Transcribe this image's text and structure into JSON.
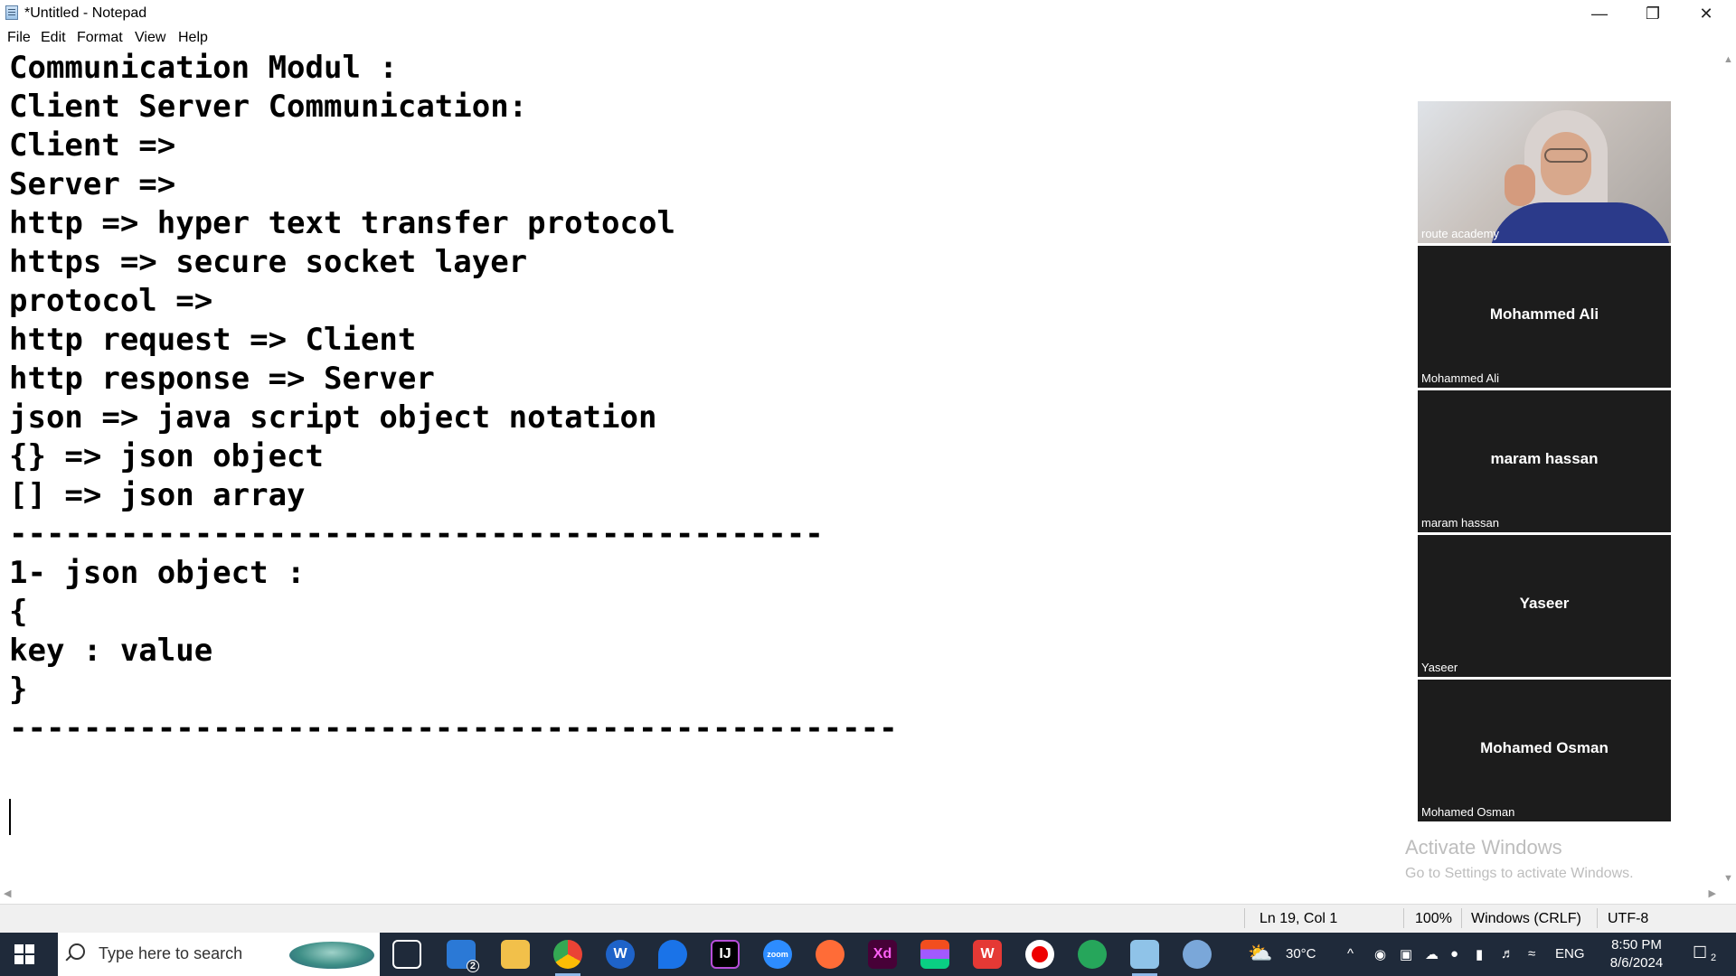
{
  "window": {
    "title": "*Untitled - Notepad",
    "controls": [
      "minimize",
      "maximize",
      "close"
    ]
  },
  "menu": [
    "File",
    "Edit",
    "Format",
    "View",
    "Help"
  ],
  "editor": {
    "lines": [
      "Communication Modul :",
      "Client Server Communication:",
      "Client =>",
      "Server =>",
      "http => hyper text transfer protocol",
      "https => secure socket layer",
      "protocol =>",
      "http request => Client",
      "http response => Server",
      "json => java script object notation",
      "{} => json object",
      "[] => json array",
      "--------------------------------------------",
      "1- json object :",
      "{",
      "key : value",
      "}",
      "------------------------------------------------",
      ""
    ]
  },
  "status": {
    "position": "Ln 19, Col 1",
    "zoom": "100%",
    "line_ending": "Windows (CRLF)",
    "encoding": "UTF-8"
  },
  "participants": [
    {
      "label": "route academy",
      "video": true
    },
    {
      "name": "Mohammed Ali",
      "label": "Mohammed Ali"
    },
    {
      "name": "maram hassan",
      "label": "maram hassan"
    },
    {
      "name": "Yaseer",
      "label": "Yaseer"
    },
    {
      "name": "Mohamed Osman",
      "label": "Mohamed Osman"
    }
  ],
  "watermark": {
    "line1": "Activate Windows",
    "line2": "Go to Settings to activate Windows."
  },
  "taskbar": {
    "search_placeholder": "Type here to search",
    "mail_badge": "2",
    "apps": [
      "start-icon",
      "task-view-icon",
      "mail-icon",
      "file-explorer-icon",
      "chrome-icon",
      "app-icon",
      "maps-icon",
      "intellij-icon",
      "zoom-icon",
      "postman-icon",
      "adobe-xd-icon",
      "figma-icon",
      "wps-icon",
      "record-icon",
      "app-icon",
      "notepad-icon",
      "paint-icon"
    ],
    "weather_temp": "30°C",
    "language": "ENG",
    "time": "8:50 PM",
    "date": "8/6/2024",
    "notification_count": "2",
    "colors": {
      "taskbar": "#1f2a3a",
      "accent": "#8fb8e8"
    }
  }
}
